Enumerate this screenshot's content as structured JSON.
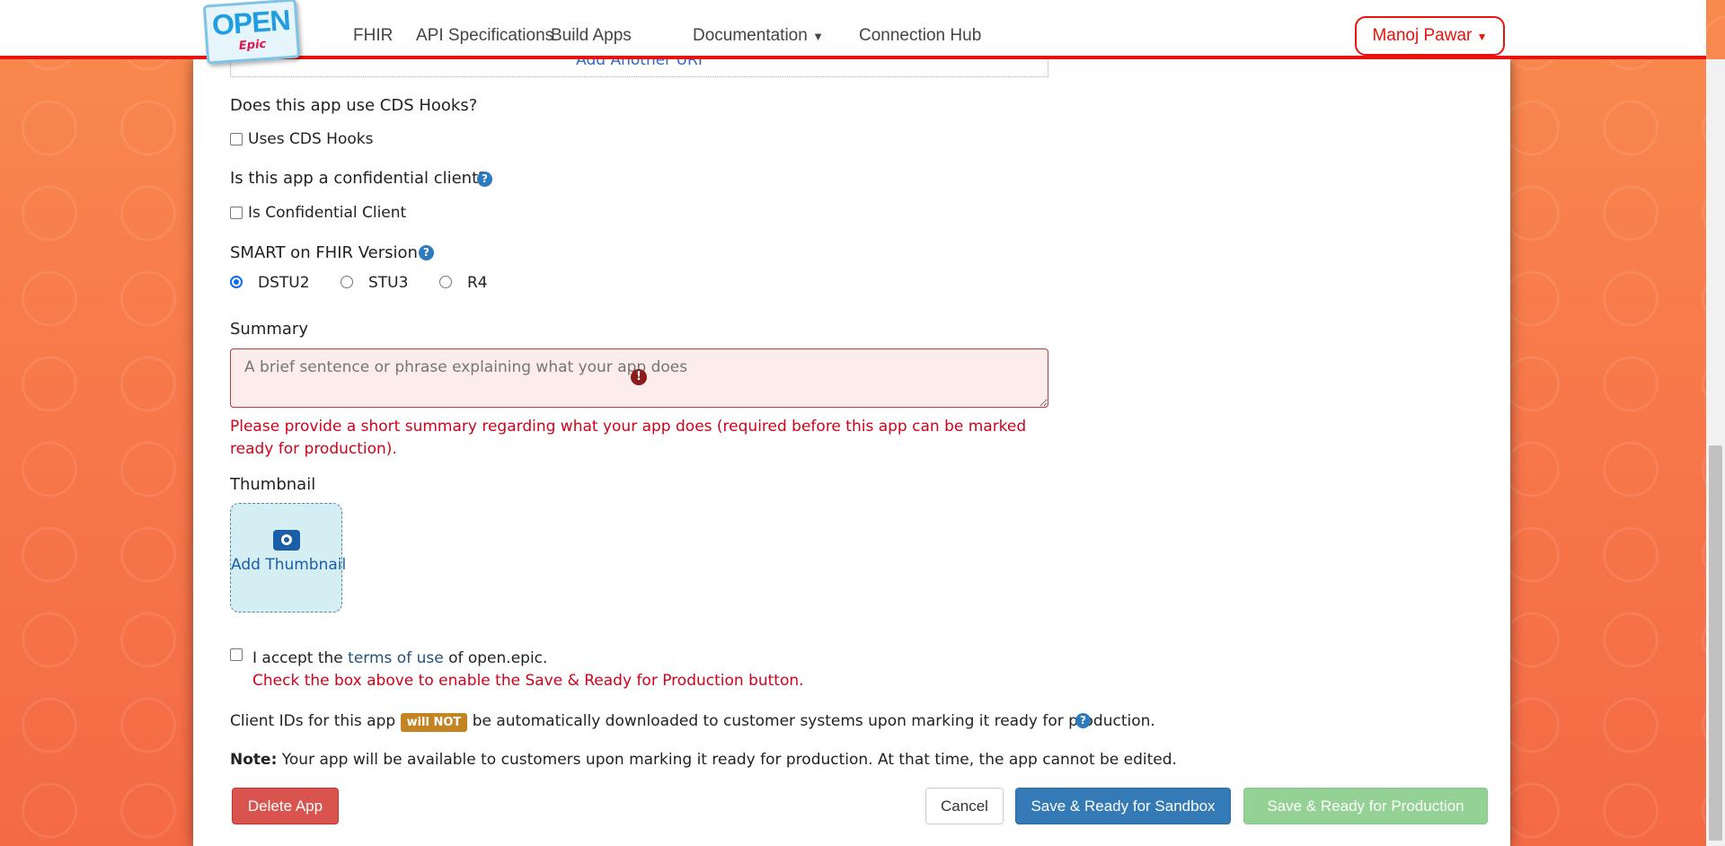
{
  "header": {
    "logo_text": "OPEN",
    "logo_sub": "Epic",
    "nav": [
      "FHIR",
      "API Specifications",
      "Build Apps",
      "Documentation",
      "Connection Hub"
    ],
    "user": "Manoj Pawar"
  },
  "form": {
    "add_uri": "Add Another URI",
    "cds_question": "Does this app use CDS Hooks?",
    "cds_label": "Uses CDS Hooks",
    "cds_checked": false,
    "conf_question": "Is this app a confidential client?",
    "conf_label": "Is Confidential Client",
    "conf_checked": false,
    "smart_label": "SMART on FHIR Version",
    "smart_options": [
      "DSTU2",
      "STU3",
      "R4"
    ],
    "smart_selected": "DSTU2",
    "summary_label": "Summary",
    "summary_placeholder": "A brief sentence or phrase explaining what your app does",
    "summary_value": "",
    "summary_error": "Please provide a short summary regarding what your app does (required before this app can be marked ready for production).",
    "thumbnail_label": "Thumbnail",
    "add_thumbnail": "Add Thumbnail",
    "terms_pre": "I accept the ",
    "terms_link": "terms of use",
    "terms_post": " of open.epic.",
    "terms_checked": false,
    "terms_error": "Check the box above to enable the Save & Ready for Production button.",
    "client_pre": "Client IDs for this app",
    "client_badge": "will NOT",
    "client_post": "be automatically downloaded to customer systems upon marking it ready for production.",
    "note_bold": "Note:",
    "note_text": " Your app will be available to customers upon marking it ready for production. At that time, the app cannot be edited."
  },
  "buttons": {
    "delete": "Delete App",
    "cancel": "Cancel",
    "sandbox": "Save & Ready for Sandbox",
    "production": "Save & Ready for Production"
  },
  "colors": {
    "accent_red": "#e8130c",
    "primary": "#337ab7",
    "danger": "#d9534f",
    "success_disabled": "#93d194",
    "badge": "#c48421"
  }
}
